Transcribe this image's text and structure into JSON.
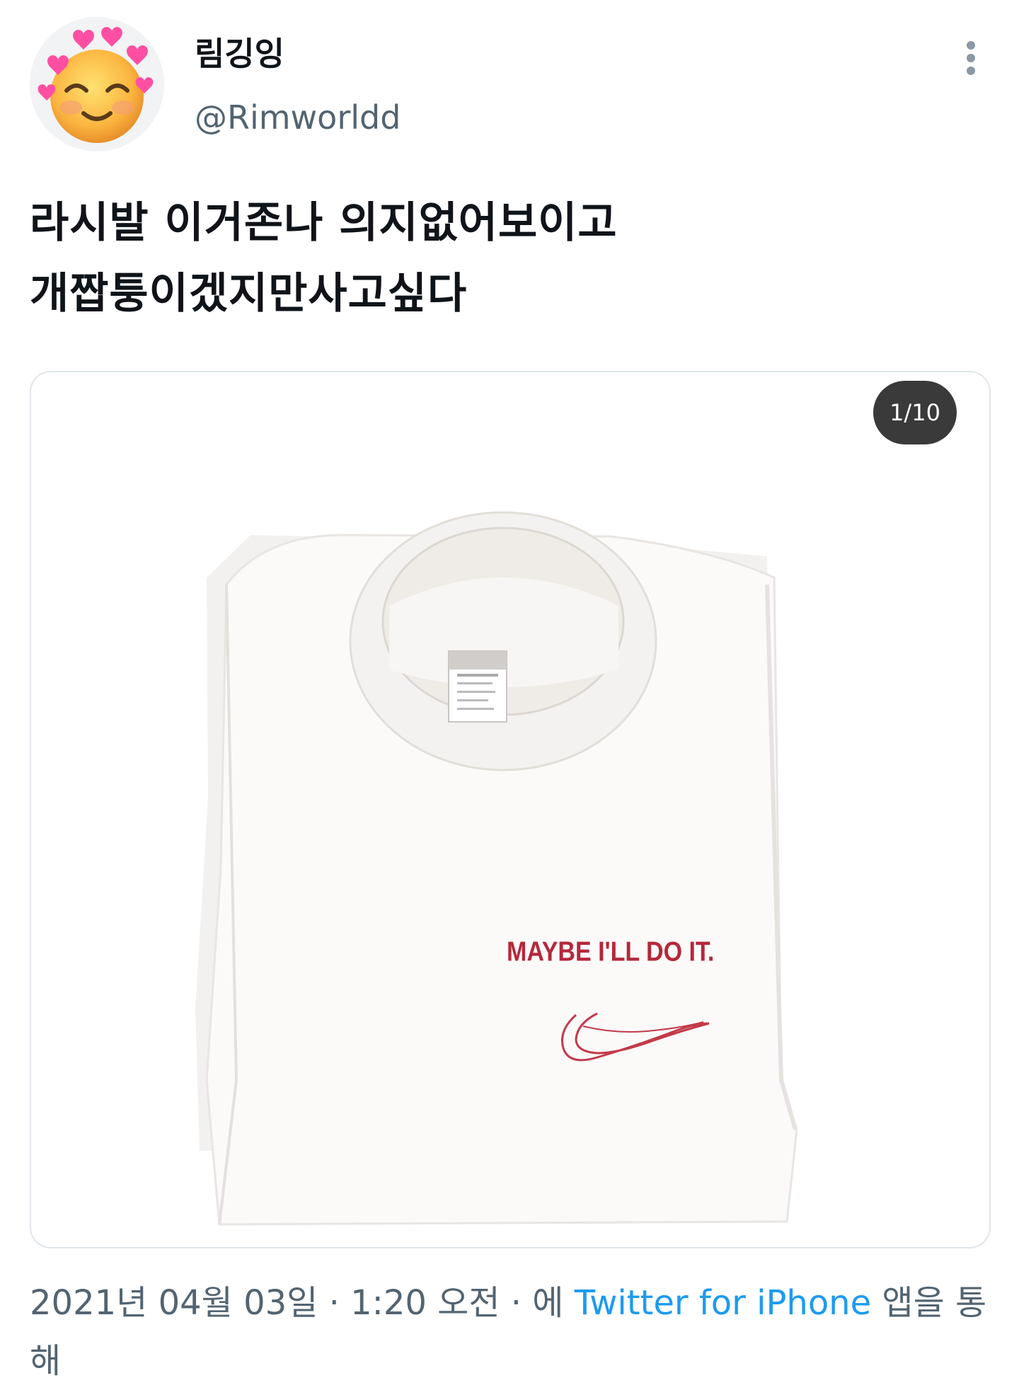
{
  "user": {
    "display_name": "림깅잉",
    "handle": "@Rimworldd",
    "avatar_icon": "smiling-face-with-hearts-icon"
  },
  "more_icon": "more-vertical-icon",
  "tweet": {
    "text": "라시발 이거존나 의지없어보이고\n개짭퉁이겠지만사고싶다"
  },
  "media": {
    "counter": "1/10",
    "shirt_print": "MAYBE I'LL DO IT."
  },
  "footer": {
    "date": "2021년 04월 03일",
    "separator": "·",
    "time": "1:20 오전",
    "via_prefix": "에",
    "source": "Twitter for iPhone",
    "suffix": "앱을 통해"
  },
  "colors": {
    "text_primary": "#0f1419",
    "text_secondary": "#536471",
    "link": "#1d9bf0",
    "print_red": "#b5283c"
  }
}
